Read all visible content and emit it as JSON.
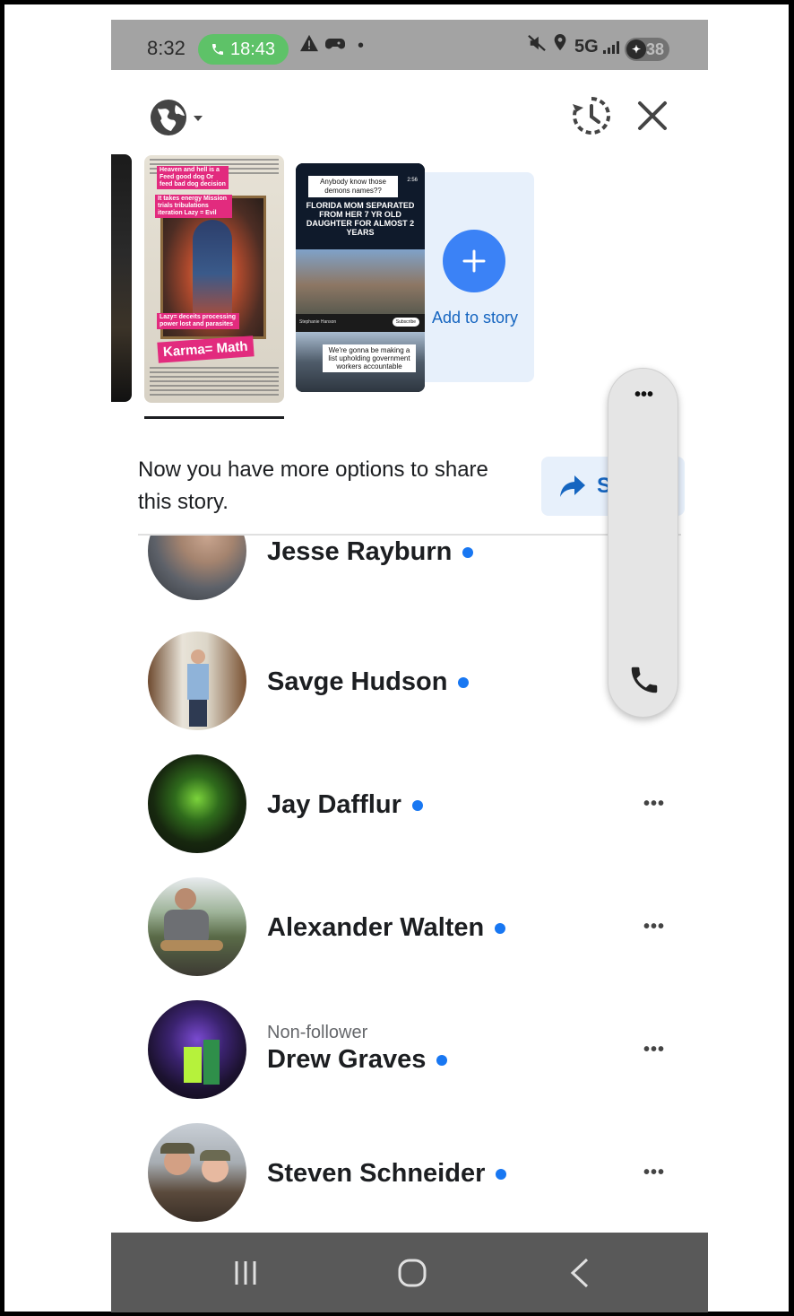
{
  "status_bar": {
    "time": "8:32",
    "call_timer": "18:43",
    "network": "5G",
    "battery": "38",
    "dot": "•"
  },
  "topbar": {
    "audience_icon": "globe-icon",
    "archive_icon": "history-icon",
    "close_icon": "close-icon"
  },
  "stories": {
    "story_one": {
      "tags": [
        "Heaven and hell is a Feed good dog Or feed bad dog decision",
        "It takes energy Mission trials tribulations iteration Lazy = Evil",
        "Lazy= deceits processing power lost and parasites"
      ],
      "tag_big": "Karma= Math"
    },
    "story_two": {
      "question": "Anybody know those demons names??",
      "headline": "FLORIDA MOM SEPARATED FROM HER 7 YR OLD DAUGHTER FOR ALMOST 2 YEARS",
      "channel": "Stephanie Hanson",
      "subscribe": "Subscribe",
      "timestamp": "2:56",
      "caption": "We're gonna be making a list upholding government workers accountable"
    },
    "add_label": "Add to story"
  },
  "notice": {
    "text": "Now you have more options to share this story.",
    "share_label": "S"
  },
  "contacts": [
    {
      "name": "Jesse Rayburn",
      "sub": "",
      "active": true
    },
    {
      "name": "Savge Hudson",
      "sub": "",
      "active": true
    },
    {
      "name": "Jay Dafflur",
      "sub": "",
      "active": true
    },
    {
      "name": "Alexander Walten",
      "sub": "",
      "active": true
    },
    {
      "name": "Drew Graves",
      "sub": "Non-follower",
      "active": true
    },
    {
      "name": "Steven Schneider",
      "sub": "",
      "active": true
    }
  ],
  "more_label": "•••",
  "floating_panel": {
    "more_label": "•••",
    "call_icon": "phone-icon"
  },
  "colors": {
    "accent": "#1877f2",
    "call_green": "#5ec268",
    "add_blue": "#3b82f6"
  }
}
